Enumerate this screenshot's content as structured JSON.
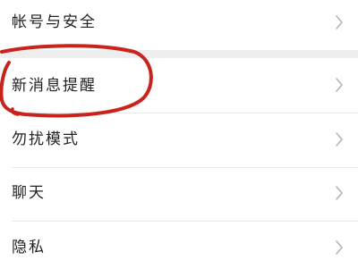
{
  "settings": {
    "items": [
      {
        "label": "帐号与安全"
      },
      {
        "label": "新消息提醒"
      },
      {
        "label": "勿扰模式"
      },
      {
        "label": "聊天"
      },
      {
        "label": "隐私"
      }
    ]
  },
  "colors": {
    "annotation_stroke": "#c8231c",
    "section_gap": "#eeeeee",
    "chevron": "#b5b5b5"
  },
  "icons": {
    "chevron": "chevron-right-icon"
  }
}
